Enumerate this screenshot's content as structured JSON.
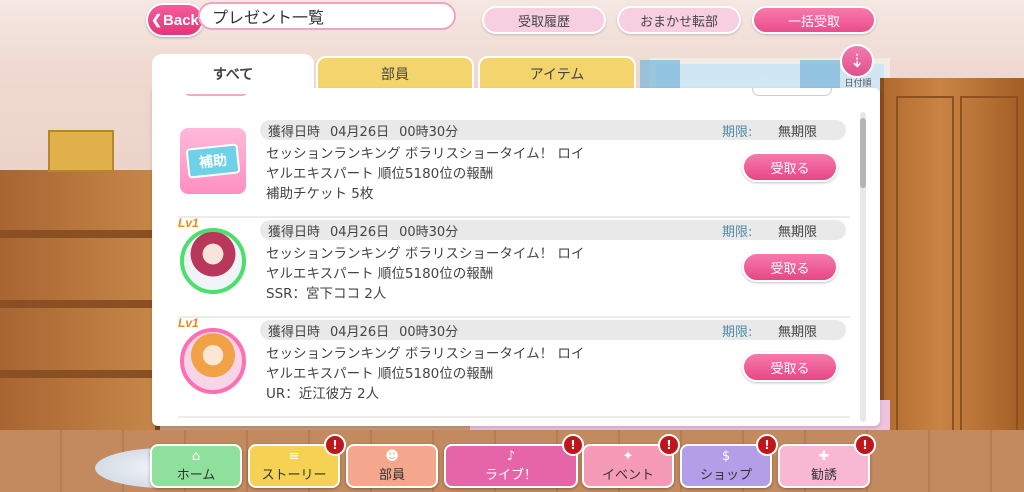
{
  "header": {
    "back_label": "Back",
    "title": "プレゼント一覧",
    "history_label": "受取履歴",
    "auto_transfer_label": "おまかせ転部",
    "receive_all_label": "一括受取",
    "sort_label": "日付順"
  },
  "tabs": [
    {
      "label": "すべて"
    },
    {
      "label": "部員"
    },
    {
      "label": "アイテム"
    }
  ],
  "presents": [
    {
      "kind": "ticket",
      "icon_text": "補助",
      "acquired_label": "獲得日時",
      "date": "04月26日",
      "time": "00時30分",
      "limit_label": "期限:",
      "limit_value": "無期限",
      "desc_line1": "セッションランキング ボラリスショータイム！ ロイ",
      "desc_line2": "ヤルエキスパート 順位5180位の報酬",
      "desc_line3": "補助チケット 5枚",
      "button_label": "受取る"
    },
    {
      "kind": "ssr",
      "level": "Lv1",
      "acquired_label": "獲得日時",
      "date": "04月26日",
      "time": "00時30分",
      "limit_label": "期限:",
      "limit_value": "無期限",
      "desc_line1": "セッションランキング ボラリスショータイム！ ロイ",
      "desc_line2": "ヤルエキスパート 順位5180位の報酬",
      "desc_line3": "SSR：宮下ココ 2人",
      "button_label": "受取る"
    },
    {
      "kind": "ur",
      "level": "Lv1",
      "acquired_label": "獲得日時",
      "date": "04月26日",
      "time": "00時30分",
      "limit_label": "期限:",
      "limit_value": "無期限",
      "desc_line1": "セッションランキング ボラリスショータイム！ ロイ",
      "desc_line2": "ヤルエキスパート 順位5180位の報酬",
      "desc_line3": "UR：近江彼方 2人",
      "button_label": "受取る"
    }
  ],
  "nav": {
    "home": "ホーム",
    "story": "ストーリー",
    "member": "部員",
    "live": "ライブ！",
    "event": "イベント",
    "shop": "ショップ",
    "recruit": "勧誘",
    "badge": "!"
  },
  "colors": {
    "accent_pink": "#e74686",
    "tab_yellow": "#f4d46d",
    "limit_blue": "#4e8ba8"
  }
}
